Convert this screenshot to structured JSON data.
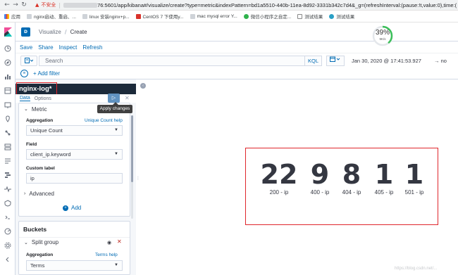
{
  "browser": {
    "insecure_label": "不安全",
    "url_text": "76:5601/app/kibana#/visualize/create?type=metric&indexPattern=bd1a5510-440b-11ea-8d92-3331b342c7d4&_g=(refreshInterval:(pause:!t,value:0),time:(",
    "bookmarks": [
      {
        "label": "应用",
        "icon": "apps-icon"
      },
      {
        "label": "nginx启动、重启、...",
        "icon": "page-icon"
      },
      {
        "label": "linux 安装nginx+p...",
        "icon": "page-icon"
      },
      {
        "label": "CentOS 7 下使用y...",
        "icon": "red-icon"
      },
      {
        "label": "mac mysql error Y...",
        "icon": "page-icon"
      },
      {
        "label": "微信小程序之自定...",
        "icon": "wechat-icon"
      },
      {
        "label": "测试结果",
        "icon": "doc-icon"
      },
      {
        "label": "测试结果",
        "icon": "db-icon"
      }
    ]
  },
  "kibana": {
    "space_badge": "D",
    "breadcrumbs": [
      "Visualize",
      "Create"
    ],
    "perf_percent": "39%",
    "perf_speed": "9K/s",
    "actions": [
      "Save",
      "Share",
      "Inspect",
      "Refresh"
    ],
    "search_placeholder": "Search",
    "kql_label": "KQL",
    "date_range": "Jan 30, 2020 @ 17:41:53.927",
    "date_arrow": "→ no",
    "add_filter": "+ Add filter"
  },
  "editor": {
    "index_pattern": "nginx-log*",
    "tabs": [
      "Data",
      "Options"
    ],
    "apply_tooltip": "Apply changes",
    "metric": {
      "title": "Metric",
      "aggregation_label": "Aggregation",
      "aggregation_help": "Unique Count help",
      "aggregation_value": "Unique Count",
      "field_label": "Field",
      "field_value": "client_ip.keyword",
      "custom_label_label": "Custom label",
      "custom_label_value": "ip",
      "advanced": "Advanced",
      "add": "Add"
    },
    "buckets": {
      "title": "Buckets",
      "split_group": "Split group",
      "aggregation_label": "Aggregation",
      "aggregation_help": "Terms help",
      "aggregation_value": "Terms"
    }
  },
  "visualization": {
    "metrics": [
      {
        "value": "22",
        "label": "200 - ip"
      },
      {
        "value": "9",
        "label": "400 - ip"
      },
      {
        "value": "8",
        "label": "404 - ip"
      },
      {
        "value": "1",
        "label": "405 - ip"
      },
      {
        "value": "1",
        "label": "501 - ip"
      }
    ]
  },
  "watermark": "https://blog.csdn.net/..."
}
